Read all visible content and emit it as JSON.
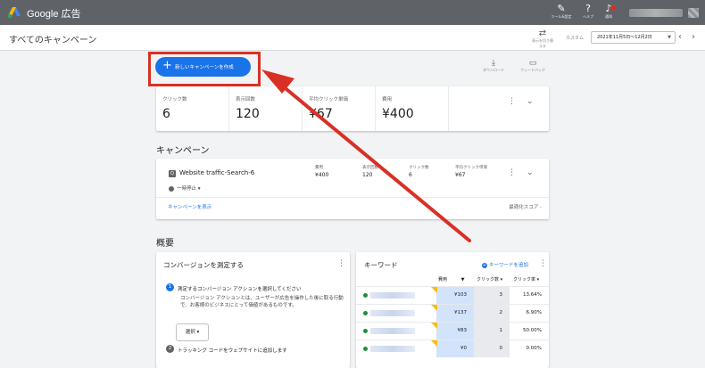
{
  "app": {
    "brand": "Google 広告"
  },
  "topbar": {
    "tools_label": "ツール&設定",
    "help_label": "ヘルプ",
    "notifications_label": "通知"
  },
  "header": {
    "title": "すべてのキャンペーン",
    "segment_label": "表示を切り替える",
    "custom_label": "カスタム",
    "date_range": "2021年11月5日〜12月2日"
  },
  "actions": {
    "create_button": "新しいキャンペーンを作成",
    "download_label": "ダウンロード",
    "feedback_label": "フィードバック"
  },
  "stats": [
    {
      "label": "クリック数",
      "value": "6"
    },
    {
      "label": "表示回数",
      "value": "120"
    },
    {
      "label": "平均クリック単価",
      "value": "¥67"
    },
    {
      "label": "費用",
      "value": "¥400"
    }
  ],
  "campaigns_section": {
    "title": "キャンペーン",
    "campaign": {
      "name": "Website traffic-Search-6",
      "status": "一時停止",
      "metrics": [
        {
          "label": "費用",
          "value": "¥400"
        },
        {
          "label": "表示回数",
          "value": "120"
        },
        {
          "label": "クリック数",
          "value": "6"
        },
        {
          "label": "平均クリック単価",
          "value": "¥67"
        }
      ]
    },
    "view_link": "キャンペーンを表示",
    "score_label": "最適化スコア -"
  },
  "overview": {
    "title": "概要",
    "conversion": {
      "title": "コンバージョンを測定する",
      "step1_num": "1",
      "step1_title": "測定するコンバージョン アクションを選択してください",
      "step1_desc": "コンバージョン アクションとは、ユーザーが広告を操作した後に取る行動で、お客様のビジネスにとって価値があるものです。",
      "select_label": "選択 ▾",
      "step2_num": "2",
      "step2_title": "トラッキング コードをウェブサイトに追加します"
    },
    "keywords": {
      "title": "キーワード",
      "add_label": "キーワードを追加",
      "columns": {
        "cost": "費用",
        "clicks": "クリック数",
        "ctr": "クリック率"
      },
      "rows": [
        {
          "cost": "¥103",
          "clicks": "3",
          "ctr": "13.64%"
        },
        {
          "cost": "¥137",
          "clicks": "2",
          "ctr": "6.90%"
        },
        {
          "cost": "¥83",
          "clicks": "1",
          "ctr": "50.00%"
        },
        {
          "cost": "¥0",
          "clicks": "0",
          "ctr": "0.00%"
        }
      ]
    }
  },
  "colors": {
    "accent": "#1a73e8",
    "highlight": "#d93025",
    "topbar": "#5f6368"
  }
}
